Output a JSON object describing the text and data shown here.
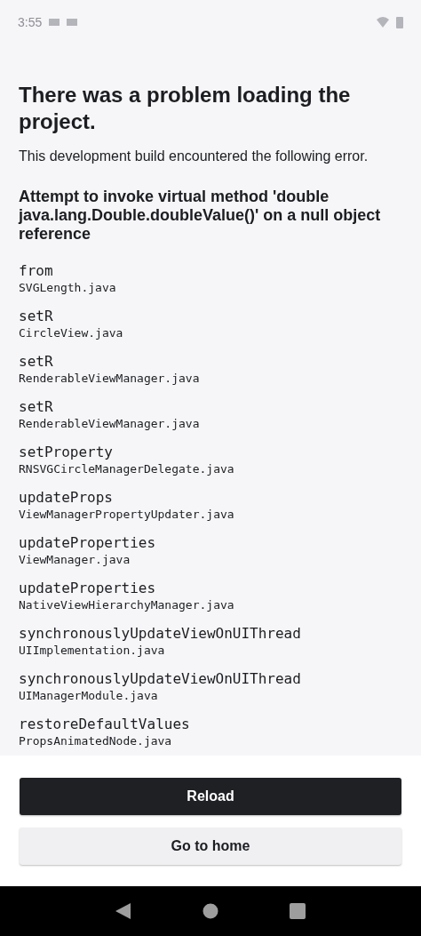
{
  "status_bar": {
    "time": "3:55"
  },
  "title": "There was a problem loading the project.",
  "subtitle": "This development build encountered the following error.",
  "error_message": "Attempt to invoke virtual method 'double java.lang.Double.doubleValue()' on a null object reference",
  "stack": [
    {
      "method": "from",
      "file": "SVGLength.java"
    },
    {
      "method": "setR",
      "file": "CircleView.java"
    },
    {
      "method": "setR",
      "file": "RenderableViewManager.java"
    },
    {
      "method": "setR",
      "file": "RenderableViewManager.java"
    },
    {
      "method": "setProperty",
      "file": "RNSVGCircleManagerDelegate.java"
    },
    {
      "method": "updateProps",
      "file": "ViewManagerPropertyUpdater.java"
    },
    {
      "method": "updateProperties",
      "file": "ViewManager.java"
    },
    {
      "method": "updateProperties",
      "file": "NativeViewHierarchyManager.java"
    },
    {
      "method": "synchronouslyUpdateViewOnUIThread",
      "file": "UIImplementation.java"
    },
    {
      "method": "synchronouslyUpdateViewOnUIThread",
      "file": "UIManagerModule.java"
    },
    {
      "method": "restoreDefaultValues",
      "file": "PropsAnimatedNode.java"
    }
  ],
  "buttons": [
    {
      "kind": "primary",
      "label": "Reload"
    },
    {
      "kind": "secondary",
      "label": "Go to home"
    }
  ]
}
